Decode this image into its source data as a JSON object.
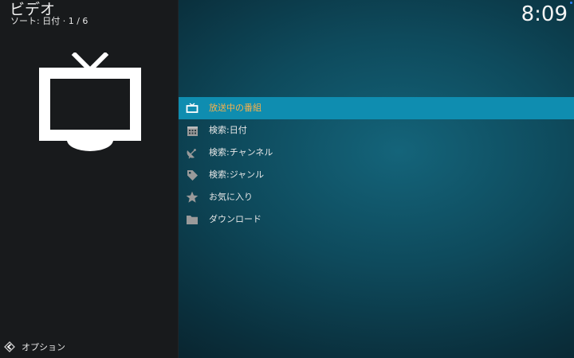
{
  "header": {
    "title": "ビデオ",
    "sort_label": "ソート: 日付",
    "position": "1 / 6",
    "clock": "8:09"
  },
  "colors": {
    "focus_background": "#0f8db0",
    "focus_text": "#f7b04b",
    "left_panel": "#181a1c"
  },
  "menu": {
    "items": [
      {
        "label": "放送中の番組",
        "icon": "tv-icon",
        "focused": true
      },
      {
        "label": "検索:日付",
        "icon": "calendar-icon",
        "focused": false
      },
      {
        "label": "検索:チャンネル",
        "icon": "satellite-dish-icon",
        "focused": false
      },
      {
        "label": "検索:ジャンル",
        "icon": "tag-icon",
        "focused": false
      },
      {
        "label": "お気に入り",
        "icon": "star-icon",
        "focused": false
      },
      {
        "label": "ダウンロード",
        "icon": "folder-icon",
        "focused": false
      }
    ]
  },
  "footer": {
    "options_label": "オプション",
    "options_icon": "options-arrow-icon"
  },
  "preview": {
    "icon": "tv-icon-large"
  }
}
